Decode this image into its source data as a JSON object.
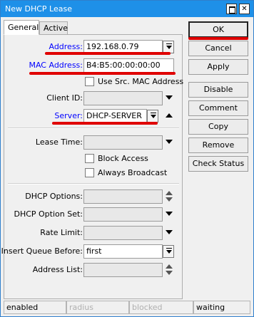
{
  "window": {
    "title": "New DHCP Lease",
    "maximize_glyph": "",
    "close_glyph": "✕"
  },
  "tabs": [
    {
      "label": "General"
    },
    {
      "label": "Active"
    }
  ],
  "form": {
    "address": {
      "label": "Address:",
      "value": "192.168.0.79"
    },
    "mac_address": {
      "label": "MAC Address:",
      "value": "B4:B5:00:00:00:00"
    },
    "use_src_mac": {
      "label": "Use Src. MAC Address",
      "checked": false
    },
    "client_id": {
      "label": "Client ID:",
      "value": ""
    },
    "server": {
      "label": "Server:",
      "value": "DHCP-SERVER"
    },
    "lease_time": {
      "label": "Lease Time:",
      "value": ""
    },
    "block_access": {
      "label": "Block Access",
      "checked": false
    },
    "always_broadcast": {
      "label": "Always Broadcast",
      "checked": false
    },
    "dhcp_options": {
      "label": "DHCP Options:",
      "value": ""
    },
    "dhcp_option_set": {
      "label": "DHCP Option Set:",
      "value": ""
    },
    "rate_limit": {
      "label": "Rate Limit:",
      "value": ""
    },
    "insert_queue_before": {
      "label": "Insert Queue Before:",
      "value": "first"
    },
    "address_list": {
      "label": "Address List:",
      "value": ""
    }
  },
  "buttons": {
    "ok": "OK",
    "cancel": "Cancel",
    "apply": "Apply",
    "disable": "Disable",
    "comment": "Comment",
    "copy": "Copy",
    "remove": "Remove",
    "check_status": "Check Status"
  },
  "status_bar": {
    "state": "enabled",
    "radius": "radius",
    "blocked": "blocked",
    "status": "waiting"
  },
  "colors": {
    "titlebar": "#1e90e8",
    "highlight_label": "#0000ff",
    "annotation_underline": "#e00000"
  }
}
